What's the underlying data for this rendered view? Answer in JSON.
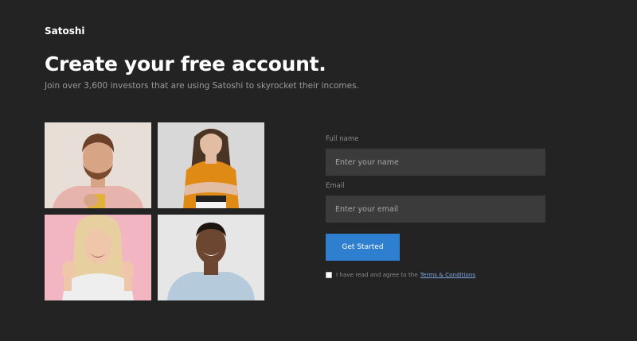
{
  "header": {
    "brand": "Satoshi",
    "title": "Create your free account.",
    "subtitle": "Join over 3,600 investors that are using Satoshi to skyrocket their incomes."
  },
  "photos": [
    {
      "name": "man-with-phone-photo",
      "bg": "#e7ded8",
      "shirt": "#e7b3ad",
      "hair": "#6a4128",
      "skin": "#d8a486"
    },
    {
      "name": "woman-orange-shirt-photo",
      "bg": "#d8d8d8",
      "shirt": "#df8a14",
      "hair": "#4a3424",
      "skin": "#e3bda3"
    },
    {
      "name": "woman-laughing-photo",
      "bg": "#f2b5c2",
      "shirt": "#eeeeee",
      "hair": "#e8cfa0",
      "skin": "#f0c6ab"
    },
    {
      "name": "man-smiling-photo",
      "bg": "#e6e6e6",
      "shirt": "#b5cbdb",
      "hair": "#1d1410",
      "skin": "#6d4632"
    }
  ],
  "form": {
    "full_name_label": "Full name",
    "full_name_placeholder": "Enter your name",
    "email_label": "Email",
    "email_placeholder": "Enter your email",
    "submit_label": "Get Started",
    "terms_text": "I have read and agree to the",
    "terms_link": "Terms & Conditions"
  },
  "colors": {
    "background": "#232323",
    "input_bg": "#3b3b3b",
    "accent": "#2f7fd0",
    "link": "#7da7e0"
  }
}
